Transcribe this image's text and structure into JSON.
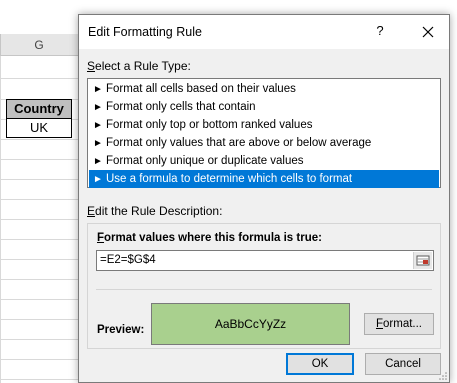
{
  "sheet": {
    "column_letter": "G",
    "header_cell": "Country",
    "value_cell": "UK"
  },
  "dialog": {
    "title": "Edit Formatting Rule",
    "help_label": "?",
    "select_rule_type_label": [
      "S",
      "elect a Rule Type:"
    ],
    "rule_types": [
      "Format all cells based on their values",
      "Format only cells that contain",
      "Format only top or bottom ranked values",
      "Format only values that are above or below average",
      "Format only unique or duplicate values",
      "Use a formula to determine which cells to format"
    ],
    "selected_rule_index": 5,
    "edit_description_label": [
      "E",
      "dit the Rule Description:"
    ],
    "formula_label": [
      "F",
      "ormat values where this formula is true:"
    ],
    "formula_value": "=E2=$G$4",
    "preview_label": "Preview:",
    "preview_text": "AaBbCcYyZz",
    "preview_fill": "#a9d08e",
    "format_button": [
      "F",
      "ormat..."
    ],
    "ok_button": "OK",
    "cancel_button": "Cancel",
    "selection_color": "#0078d7"
  }
}
